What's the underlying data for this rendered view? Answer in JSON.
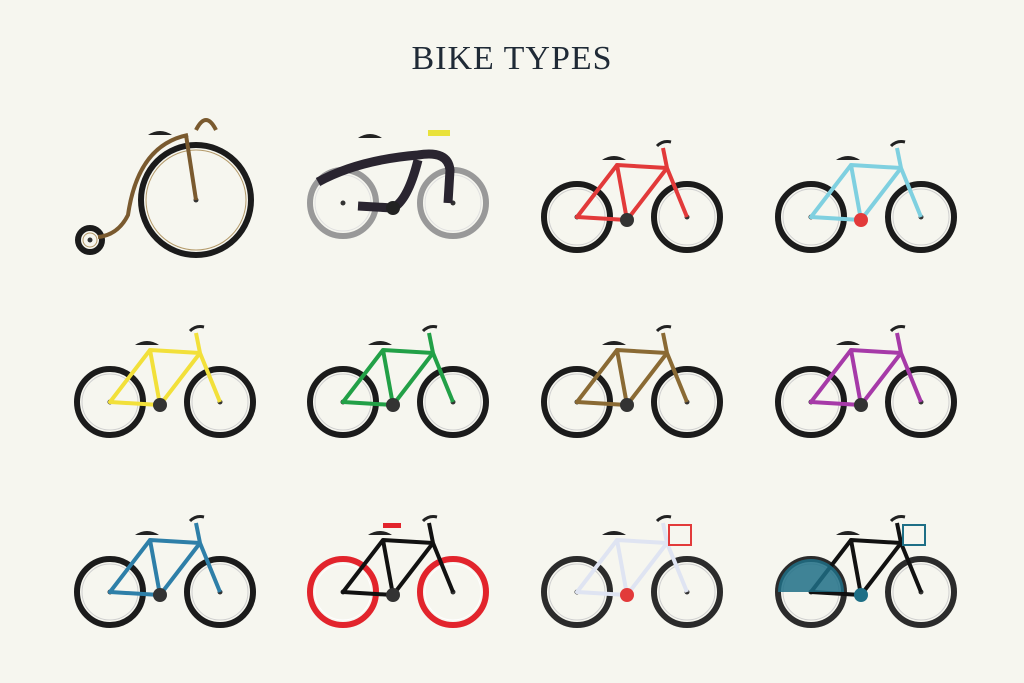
{
  "title": "BIKE TYPES",
  "bikes": [
    {
      "id": "penny-farthing",
      "icon": "penny-farthing-bike-icon",
      "frame": "#7a5a2f",
      "tire": "#1b1b1b"
    },
    {
      "id": "futuristic",
      "icon": "futuristic-bike-icon",
      "frame": "#2a2530",
      "tire": "#999999",
      "accent": "#e9e23a"
    },
    {
      "id": "cruiser-red",
      "icon": "red-cruiser-bike-icon",
      "frame": "#e23a3a",
      "tire": "#1b1b1b"
    },
    {
      "id": "step-through-lightblue",
      "icon": "light-blue-city-bike-icon",
      "frame": "#7fd0e0",
      "tire": "#1b1b1b",
      "accent": "#e23a3a"
    },
    {
      "id": "yellow-city",
      "icon": "yellow-city-bike-icon",
      "frame": "#f2e03a",
      "tire": "#1b1b1b"
    },
    {
      "id": "folding-green",
      "icon": "green-folding-bike-icon",
      "frame": "#22a047",
      "tire": "#1b1b1b"
    },
    {
      "id": "dutch-brown",
      "icon": "brown-dutch-bike-icon",
      "frame": "#8a6a34",
      "tire": "#1b1b1b"
    },
    {
      "id": "purple-city",
      "icon": "purple-city-bike-icon",
      "frame": "#a63aa8",
      "tire": "#1b1b1b"
    },
    {
      "id": "blue-dutch",
      "icon": "blue-dutch-bike-icon",
      "frame": "#2e7fa8",
      "tire": "#1b1b1b"
    },
    {
      "id": "chopper",
      "icon": "chopper-bike-icon",
      "frame": "#111111",
      "tire": "#e2242c"
    },
    {
      "id": "basket-white",
      "icon": "white-basket-bike-icon",
      "frame": "#dfe4f2",
      "tire": "#2b2b2b",
      "accent": "#e23a3a"
    },
    {
      "id": "basket-teal",
      "icon": "teal-basket-bike-icon",
      "frame": "#111111",
      "tire": "#2b2b2b",
      "accent": "#1e6f86"
    }
  ]
}
